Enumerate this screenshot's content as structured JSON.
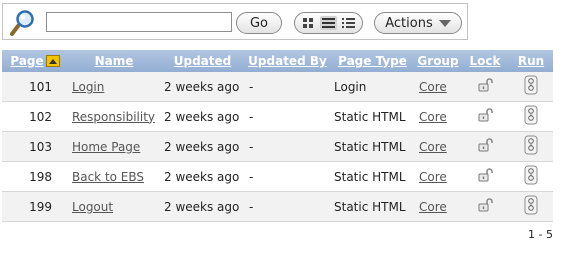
{
  "search": {
    "value": "",
    "placeholder": ""
  },
  "toolbar": {
    "go_label": "Go",
    "actions_label": "Actions",
    "views": [
      "icon-view",
      "report-view",
      "detail-view"
    ],
    "active_view": "report-view"
  },
  "table": {
    "headers": {
      "page": "Page",
      "name": "Name",
      "updated": "Updated",
      "updated_by": "Updated By",
      "page_type": "Page Type",
      "group": "Group",
      "lock": "Lock",
      "run": "Run"
    },
    "sort": {
      "column": "page",
      "direction": "ascending"
    },
    "rows": [
      {
        "page": "101",
        "name": "Login",
        "updated": "2 weeks ago",
        "updated_by": "-",
        "page_type": "Login",
        "group": "Core",
        "lock_icon": "unlocked-padlock-icon",
        "run_icon": "run-page-icon"
      },
      {
        "page": "102",
        "name": "Responsibility",
        "updated": "2 weeks ago",
        "updated_by": "-",
        "page_type": "Static HTML",
        "group": "Core",
        "lock_icon": "unlocked-padlock-icon",
        "run_icon": "run-page-icon"
      },
      {
        "page": "103",
        "name": "Home Page",
        "updated": "2 weeks ago",
        "updated_by": "-",
        "page_type": "Static HTML",
        "group": "Core",
        "lock_icon": "unlocked-padlock-icon",
        "run_icon": "run-page-icon"
      },
      {
        "page": "198",
        "name": "Back to EBS",
        "updated": "2 weeks ago",
        "updated_by": "-",
        "page_type": "Static HTML",
        "group": "Core",
        "lock_icon": "unlocked-padlock-icon",
        "run_icon": "run-page-icon"
      },
      {
        "page": "199",
        "name": "Logout",
        "updated": "2 weeks ago",
        "updated_by": "-",
        "page_type": "Static HTML",
        "group": "Core",
        "lock_icon": "unlocked-padlock-icon",
        "run_icon": "run-page-icon"
      }
    ]
  },
  "pagination": {
    "range": "1 - 5"
  },
  "colors": {
    "header_gradient_top": "#b2c6e1",
    "header_gradient_bottom": "#93aed3",
    "sort_indicator": "#f3c300",
    "row_alt": "#f2f2f2"
  }
}
